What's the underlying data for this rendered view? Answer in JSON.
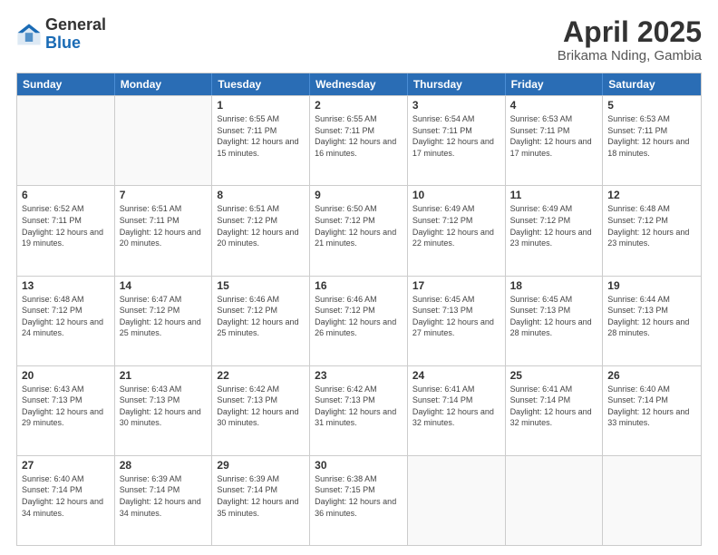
{
  "logo": {
    "general": "General",
    "blue": "Blue"
  },
  "title": "April 2025",
  "subtitle": "Brikama Nding, Gambia",
  "weekdays": [
    "Sunday",
    "Monday",
    "Tuesday",
    "Wednesday",
    "Thursday",
    "Friday",
    "Saturday"
  ],
  "weeks": [
    [
      {
        "day": "",
        "info": ""
      },
      {
        "day": "",
        "info": ""
      },
      {
        "day": "1",
        "info": "Sunrise: 6:55 AM\nSunset: 7:11 PM\nDaylight: 12 hours and 15 minutes."
      },
      {
        "day": "2",
        "info": "Sunrise: 6:55 AM\nSunset: 7:11 PM\nDaylight: 12 hours and 16 minutes."
      },
      {
        "day": "3",
        "info": "Sunrise: 6:54 AM\nSunset: 7:11 PM\nDaylight: 12 hours and 17 minutes."
      },
      {
        "day": "4",
        "info": "Sunrise: 6:53 AM\nSunset: 7:11 PM\nDaylight: 12 hours and 17 minutes."
      },
      {
        "day": "5",
        "info": "Sunrise: 6:53 AM\nSunset: 7:11 PM\nDaylight: 12 hours and 18 minutes."
      }
    ],
    [
      {
        "day": "6",
        "info": "Sunrise: 6:52 AM\nSunset: 7:11 PM\nDaylight: 12 hours and 19 minutes."
      },
      {
        "day": "7",
        "info": "Sunrise: 6:51 AM\nSunset: 7:11 PM\nDaylight: 12 hours and 20 minutes."
      },
      {
        "day": "8",
        "info": "Sunrise: 6:51 AM\nSunset: 7:12 PM\nDaylight: 12 hours and 20 minutes."
      },
      {
        "day": "9",
        "info": "Sunrise: 6:50 AM\nSunset: 7:12 PM\nDaylight: 12 hours and 21 minutes."
      },
      {
        "day": "10",
        "info": "Sunrise: 6:49 AM\nSunset: 7:12 PM\nDaylight: 12 hours and 22 minutes."
      },
      {
        "day": "11",
        "info": "Sunrise: 6:49 AM\nSunset: 7:12 PM\nDaylight: 12 hours and 23 minutes."
      },
      {
        "day": "12",
        "info": "Sunrise: 6:48 AM\nSunset: 7:12 PM\nDaylight: 12 hours and 23 minutes."
      }
    ],
    [
      {
        "day": "13",
        "info": "Sunrise: 6:48 AM\nSunset: 7:12 PM\nDaylight: 12 hours and 24 minutes."
      },
      {
        "day": "14",
        "info": "Sunrise: 6:47 AM\nSunset: 7:12 PM\nDaylight: 12 hours and 25 minutes."
      },
      {
        "day": "15",
        "info": "Sunrise: 6:46 AM\nSunset: 7:12 PM\nDaylight: 12 hours and 25 minutes."
      },
      {
        "day": "16",
        "info": "Sunrise: 6:46 AM\nSunset: 7:12 PM\nDaylight: 12 hours and 26 minutes."
      },
      {
        "day": "17",
        "info": "Sunrise: 6:45 AM\nSunset: 7:13 PM\nDaylight: 12 hours and 27 minutes."
      },
      {
        "day": "18",
        "info": "Sunrise: 6:45 AM\nSunset: 7:13 PM\nDaylight: 12 hours and 28 minutes."
      },
      {
        "day": "19",
        "info": "Sunrise: 6:44 AM\nSunset: 7:13 PM\nDaylight: 12 hours and 28 minutes."
      }
    ],
    [
      {
        "day": "20",
        "info": "Sunrise: 6:43 AM\nSunset: 7:13 PM\nDaylight: 12 hours and 29 minutes."
      },
      {
        "day": "21",
        "info": "Sunrise: 6:43 AM\nSunset: 7:13 PM\nDaylight: 12 hours and 30 minutes."
      },
      {
        "day": "22",
        "info": "Sunrise: 6:42 AM\nSunset: 7:13 PM\nDaylight: 12 hours and 30 minutes."
      },
      {
        "day": "23",
        "info": "Sunrise: 6:42 AM\nSunset: 7:13 PM\nDaylight: 12 hours and 31 minutes."
      },
      {
        "day": "24",
        "info": "Sunrise: 6:41 AM\nSunset: 7:14 PM\nDaylight: 12 hours and 32 minutes."
      },
      {
        "day": "25",
        "info": "Sunrise: 6:41 AM\nSunset: 7:14 PM\nDaylight: 12 hours and 32 minutes."
      },
      {
        "day": "26",
        "info": "Sunrise: 6:40 AM\nSunset: 7:14 PM\nDaylight: 12 hours and 33 minutes."
      }
    ],
    [
      {
        "day": "27",
        "info": "Sunrise: 6:40 AM\nSunset: 7:14 PM\nDaylight: 12 hours and 34 minutes."
      },
      {
        "day": "28",
        "info": "Sunrise: 6:39 AM\nSunset: 7:14 PM\nDaylight: 12 hours and 34 minutes."
      },
      {
        "day": "29",
        "info": "Sunrise: 6:39 AM\nSunset: 7:14 PM\nDaylight: 12 hours and 35 minutes."
      },
      {
        "day": "30",
        "info": "Sunrise: 6:38 AM\nSunset: 7:15 PM\nDaylight: 12 hours and 36 minutes."
      },
      {
        "day": "",
        "info": ""
      },
      {
        "day": "",
        "info": ""
      },
      {
        "day": "",
        "info": ""
      }
    ]
  ]
}
